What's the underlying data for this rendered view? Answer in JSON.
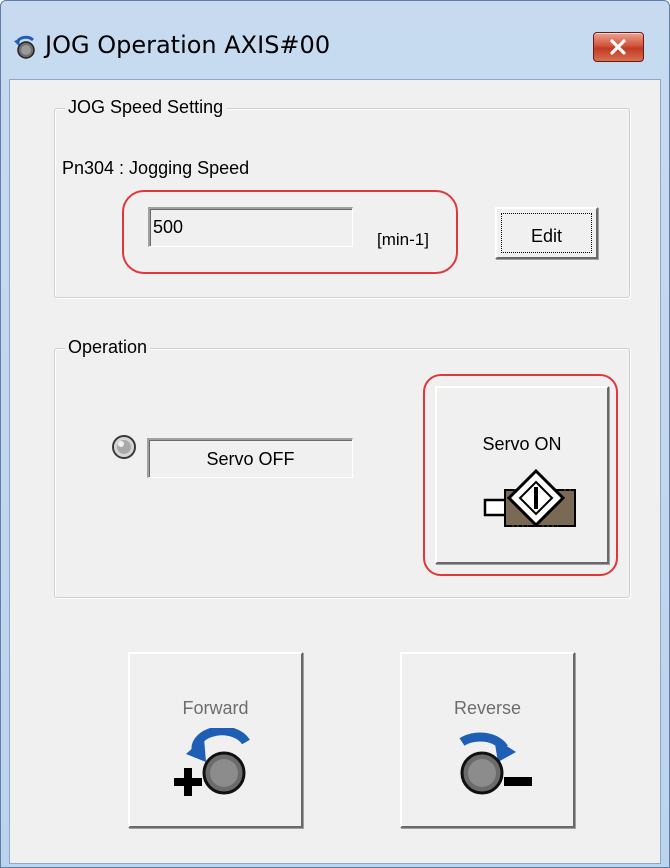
{
  "window": {
    "title": "JOG Operation AXIS#00"
  },
  "speed_group": {
    "legend": "JOG Speed Setting",
    "param_label": "Pn304 : Jogging Speed",
    "value": "500",
    "unit": "[min-1]",
    "edit_label": "Edit"
  },
  "operation_group": {
    "legend": "Operation",
    "status_text": "Servo OFF",
    "servo_button_label": "Servo ON"
  },
  "jog_buttons": {
    "forward_label": "Forward",
    "reverse_label": "Reverse",
    "enabled": false
  },
  "colors": {
    "highlight": "#e3363a",
    "arrow": "#1e5fb5",
    "motor_body": "#7a6a55"
  },
  "icons": [
    "jog-window-icon",
    "close-icon",
    "servo-led-icon",
    "servo-on-icon",
    "forward-jog-icon",
    "reverse-jog-icon"
  ]
}
